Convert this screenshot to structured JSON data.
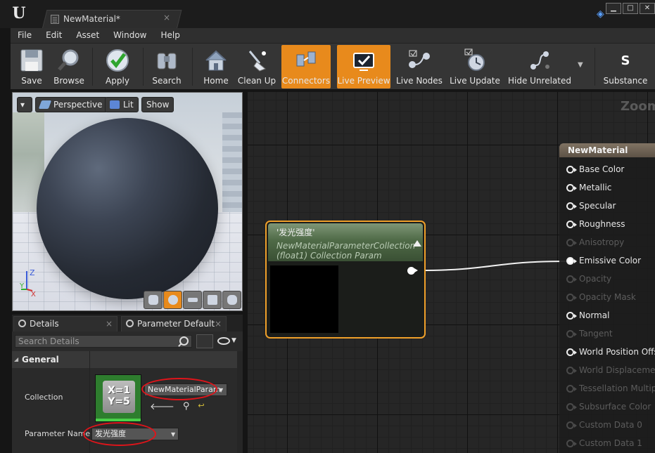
{
  "window": {
    "tab_title": "NewMaterial*",
    "tab_close": "×",
    "controls": [
      "▁",
      "□",
      "✕"
    ]
  },
  "menu": [
    "File",
    "Edit",
    "Asset",
    "Window",
    "Help"
  ],
  "toolbar": {
    "buttons": [
      {
        "label": "Save",
        "icon": "floppy-disk-icon"
      },
      {
        "label": "Browse",
        "icon": "magnifier-icon"
      },
      {
        "label": "Apply",
        "icon": "checkmark-icon"
      },
      {
        "label": "Search",
        "icon": "binoculars-icon"
      },
      {
        "label": "Home",
        "icon": "house-icon"
      },
      {
        "label": "Clean Up",
        "icon": "broom-icon"
      },
      {
        "label": "Connectors",
        "icon": "connectors-icon",
        "active": true
      },
      {
        "label": "Live Preview",
        "icon": "monitor-icon",
        "active": true
      },
      {
        "label": "Live Nodes",
        "icon": "live-nodes-icon"
      },
      {
        "label": "Live Update",
        "icon": "refresh-clock-icon"
      },
      {
        "label": "Hide Unrelated",
        "icon": "hide-unrelated-icon"
      },
      {
        "label": "Substance",
        "icon": "substance-icon"
      }
    ],
    "accent": "#e88a1c"
  },
  "viewport": {
    "dropdown": "▾",
    "perspective": "Perspective",
    "lit": "Lit",
    "show": "Show",
    "axis_z": "Z",
    "axis_y": "Y",
    "axis_x": "X"
  },
  "details": {
    "tabs": [
      {
        "label": "Details",
        "close": "×"
      },
      {
        "label": "Parameter Default",
        "close": "×"
      }
    ],
    "search_placeholder": "Search Details",
    "category": "General",
    "collection_label": "Collection",
    "collection_value": "NewMaterialParam",
    "collection_thumb_text_1": "X=1",
    "collection_thumb_text_2": "Y=5",
    "tools": [
      "🡐",
      "⚲",
      "↩"
    ],
    "parameter_name_label": "Parameter Name",
    "parameter_name_value": "发光强度"
  },
  "graph": {
    "zoom": "Zoom",
    "param_node": {
      "title": "'发光强度'",
      "subtitle_1": "NewMaterialParameterCollection",
      "subtitle_2": "(float1) Collection Param"
    },
    "material_node": {
      "title": "NewMaterial",
      "pins": [
        {
          "label": "Base Color",
          "enabled": true
        },
        {
          "label": "Metallic",
          "enabled": true
        },
        {
          "label": "Specular",
          "enabled": true
        },
        {
          "label": "Roughness",
          "enabled": true
        },
        {
          "label": "Anisotropy",
          "enabled": false
        },
        {
          "label": "Emissive Color",
          "enabled": true,
          "connected": true
        },
        {
          "label": "Opacity",
          "enabled": false
        },
        {
          "label": "Opacity Mask",
          "enabled": false
        },
        {
          "label": "Normal",
          "enabled": true
        },
        {
          "label": "Tangent",
          "enabled": false
        },
        {
          "label": "World Position Offse",
          "enabled": true
        },
        {
          "label": "World Displacemen",
          "enabled": false
        },
        {
          "label": "Tessellation Multipl",
          "enabled": false
        },
        {
          "label": "Subsurface Color",
          "enabled": false
        },
        {
          "label": "Custom Data 0",
          "enabled": false
        },
        {
          "label": "Custom Data 1",
          "enabled": false
        }
      ]
    }
  }
}
